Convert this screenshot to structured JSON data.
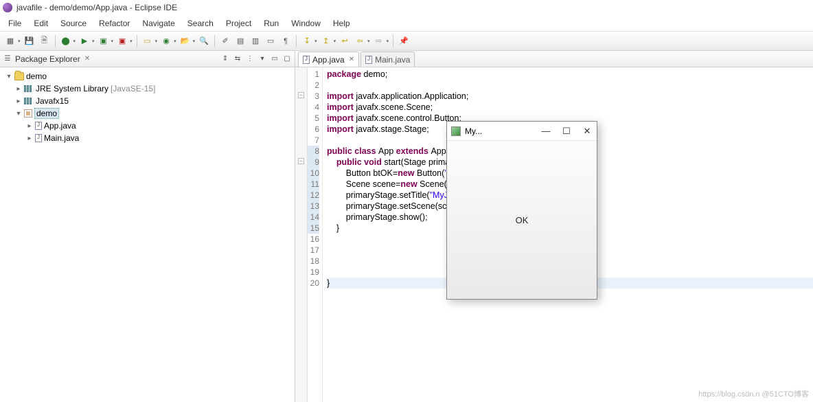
{
  "window": {
    "title": "javafile - demo/demo/App.java - Eclipse IDE"
  },
  "menu": [
    "File",
    "Edit",
    "Source",
    "Refactor",
    "Navigate",
    "Search",
    "Project",
    "Run",
    "Window",
    "Help"
  ],
  "explorer": {
    "title": "Package Explorer",
    "project": "demo",
    "items": [
      {
        "label": "JRE System Library",
        "suffix": "[JavaSE-15]"
      },
      {
        "label": "Javafx15"
      },
      {
        "label": "demo"
      }
    ],
    "files": [
      "App.java",
      "Main.java"
    ]
  },
  "tabs": [
    {
      "label": "App.java",
      "active": true
    },
    {
      "label": "Main.java",
      "active": false
    }
  ],
  "code": {
    "lines": [
      {
        "n": "1",
        "segs": [
          {
            "t": "package ",
            "c": "kw"
          },
          {
            "t": "demo;",
            "c": "plain"
          }
        ]
      },
      {
        "n": "2",
        "segs": []
      },
      {
        "n": "3",
        "fold": true,
        "segs": [
          {
            "t": "import ",
            "c": "kw"
          },
          {
            "t": "javafx.application.Application;",
            "c": "plain"
          }
        ]
      },
      {
        "n": "4",
        "segs": [
          {
            "t": "import ",
            "c": "kw"
          },
          {
            "t": "javafx.scene.Scene;",
            "c": "plain"
          }
        ]
      },
      {
        "n": "5",
        "segs": [
          {
            "t": "import ",
            "c": "kw"
          },
          {
            "t": "javafx.scene.control.Button;",
            "c": "plain"
          }
        ]
      },
      {
        "n": "6",
        "segs": [
          {
            "t": "import ",
            "c": "kw"
          },
          {
            "t": "javafx.stage.Stage;",
            "c": "plain"
          }
        ]
      },
      {
        "n": "7",
        "segs": []
      },
      {
        "n": "8",
        "mk": true,
        "segs": [
          {
            "t": "public class ",
            "c": "kw"
          },
          {
            "t": "App ",
            "c": "plain"
          },
          {
            "t": "extends ",
            "c": "kw"
          },
          {
            "t": "Applicati",
            "c": "plain"
          }
        ]
      },
      {
        "n": "9",
        "mk": true,
        "fold": true,
        "segs": [
          {
            "t": "    public void ",
            "c": "kw"
          },
          {
            "t": "start(Stage ",
            "c": "plain"
          },
          {
            "t": "primar",
            "c": "plain"
          }
        ]
      },
      {
        "n": "10",
        "mk": true,
        "segs": [
          {
            "t": "        Button btOK=",
            "c": "plain"
          },
          {
            "t": "new ",
            "c": "kw"
          },
          {
            "t": "Button(",
            "c": "plain"
          },
          {
            "t": "\"OK",
            "c": "str"
          }
        ]
      },
      {
        "n": "11",
        "mk": true,
        "segs": [
          {
            "t": "        Scene scene=",
            "c": "plain"
          },
          {
            "t": "new ",
            "c": "kw"
          },
          {
            "t": "Scene(btOK",
            "c": "plain"
          }
        ]
      },
      {
        "n": "12",
        "mk": true,
        "segs": [
          {
            "t": "        primaryStage.setTitle(",
            "c": "plain"
          },
          {
            "t": "\"MyJ",
            "c": "str"
          }
        ]
      },
      {
        "n": "13",
        "mk": true,
        "segs": [
          {
            "t": "        primaryStage.setScene(scen",
            "c": "plain"
          }
        ]
      },
      {
        "n": "14",
        "mk": true,
        "segs": [
          {
            "t": "        primaryStage.show();",
            "c": "plain"
          }
        ]
      },
      {
        "n": "15",
        "mk": true,
        "segs": [
          {
            "t": "    }",
            "c": "plain"
          }
        ]
      },
      {
        "n": "16",
        "segs": []
      },
      {
        "n": "17",
        "segs": []
      },
      {
        "n": "18",
        "segs": []
      },
      {
        "n": "19",
        "segs": []
      },
      {
        "n": "20",
        "cur": true,
        "segs": [
          {
            "t": "}",
            "c": "plain"
          }
        ]
      }
    ]
  },
  "fx": {
    "title": "My...",
    "button": "OK",
    "min": "—",
    "max": "☐",
    "close": "✕"
  },
  "watermark": "https://blog.csdn.n  @51CTO博客"
}
